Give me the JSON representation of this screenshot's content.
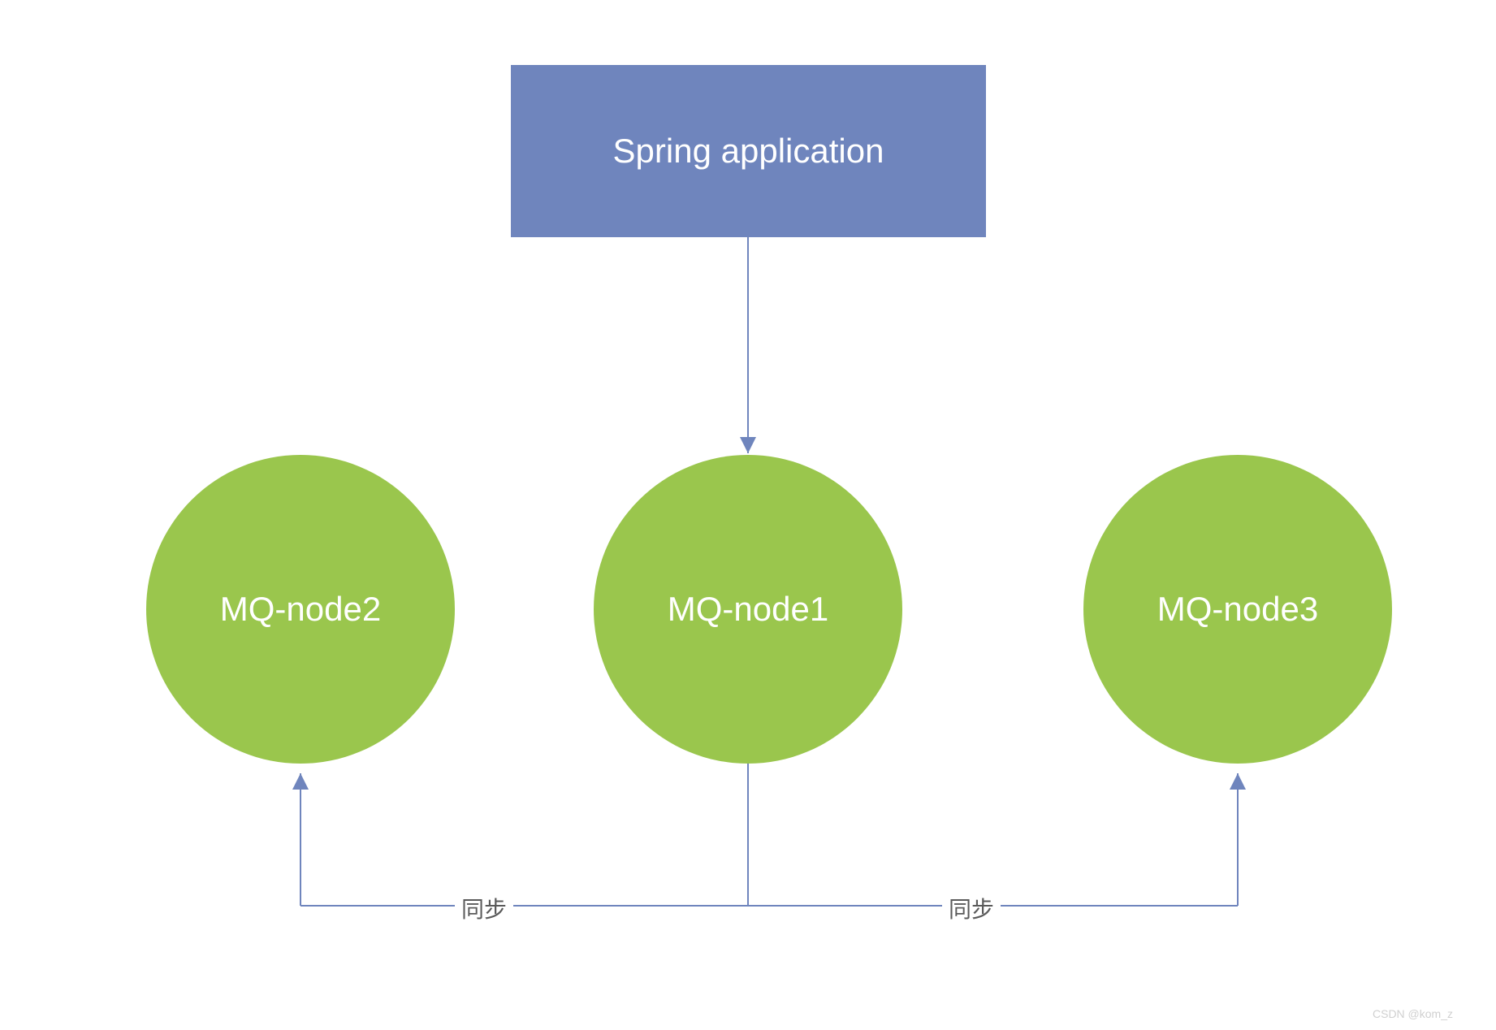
{
  "app_box": {
    "label": "Spring application"
  },
  "nodes": {
    "left": {
      "label": "MQ-node2"
    },
    "center": {
      "label": "MQ-node1"
    },
    "right": {
      "label": "MQ-node3"
    }
  },
  "sync": {
    "left_label": "同步",
    "right_label": "同步"
  },
  "watermark": {
    "text": "CSDN @kom_z"
  },
  "colors": {
    "box_bg": "#6f85bd",
    "circle_bg": "#9ac64d",
    "connector": "#6f85bd",
    "text_white": "#ffffff"
  }
}
